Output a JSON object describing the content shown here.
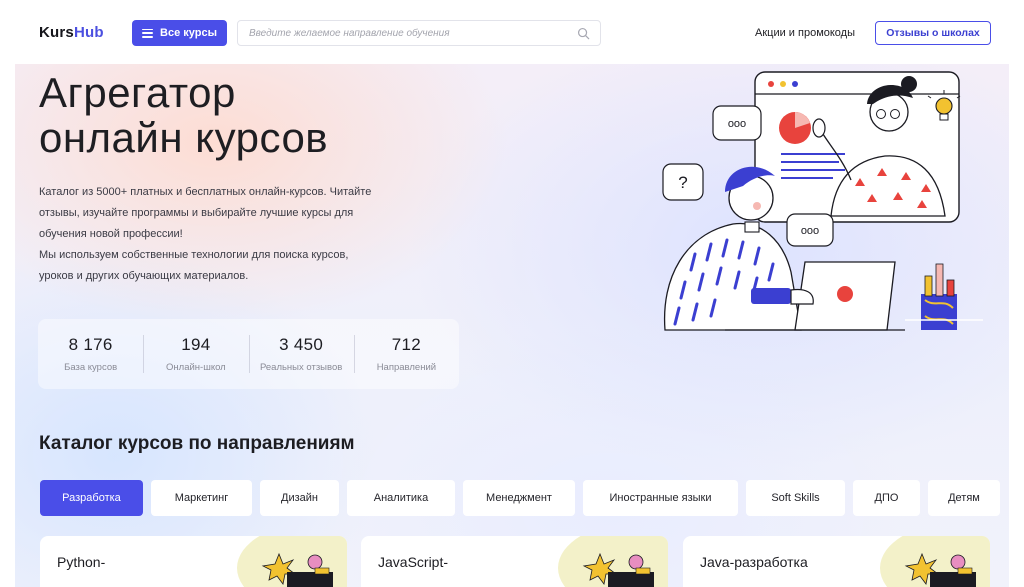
{
  "header": {
    "logo_part1": "Kurs",
    "logo_part2": "Hub",
    "all_courses_label": "Все курсы",
    "search_placeholder": "Введите желаемое направление обучения",
    "promo_link": "Акции и промокоды",
    "reviews_button": "Отзывы о школах"
  },
  "hero": {
    "title_line1": "Агрегатор",
    "title_line2": "онлайн курсов",
    "desc_lines": [
      "Каталог из 5000+ платных и бесплатных онлайн-курсов. Читайте",
      "отзывы, изучайте программы и выбирайте лучшие курсы для",
      "обучения новой профессии!",
      "Мы используем собственные технологии для поиска курсов,",
      "уроков и других обучающих материалов."
    ],
    "bubble_question": "?",
    "bubble_dots": "ooo"
  },
  "stats": [
    {
      "value": "8 176",
      "label": "База курсов"
    },
    {
      "value": "194",
      "label": "Онлайн-школ"
    },
    {
      "value": "3 450",
      "label": "Реальных отзывов"
    },
    {
      "value": "712",
      "label": "Направлений"
    }
  ],
  "catalog": {
    "title": "Каталог курсов по направлениям",
    "tabs": [
      "Разработка",
      "Маркетинг",
      "Дизайн",
      "Аналитика",
      "Менеджмент",
      "Иностранные языки",
      "Soft Skills",
      "ДПО",
      "Детям"
    ],
    "active_tab": "Разработка",
    "cards": [
      {
        "title": "Python-"
      },
      {
        "title": "JavaScript-"
      },
      {
        "title": "Java-разработка"
      }
    ]
  },
  "colors": {
    "accent": "#4a4ee8",
    "illustration_red": "#e8433d",
    "illustration_blue": "#3b3fd1",
    "card_highlight": "#f3f1c9"
  },
  "icons": [
    "burger-icon",
    "search-icon"
  ]
}
